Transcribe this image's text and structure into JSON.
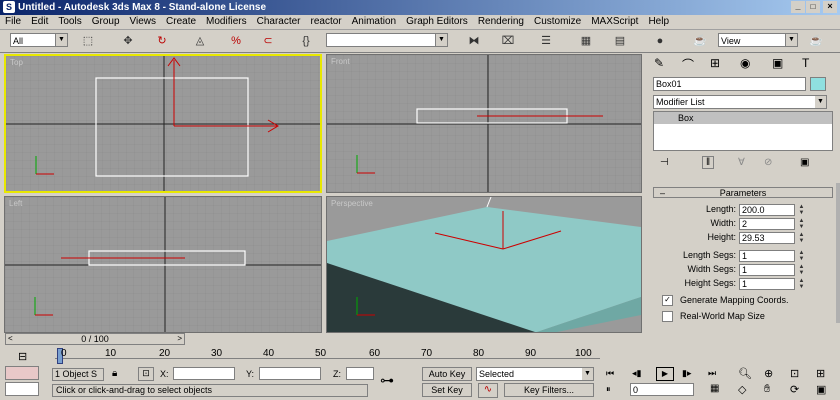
{
  "window": {
    "title": "Untitled - Autodesk 3ds Max 8 - Stand-alone License"
  },
  "menu": [
    "File",
    "Edit",
    "Tools",
    "Group",
    "Views",
    "Create",
    "Modifiers",
    "Character",
    "reactor",
    "Animation",
    "Graph Editors",
    "Rendering",
    "Customize",
    "MAXScript",
    "Help"
  ],
  "toolbar": {
    "selection_filter": "All",
    "named_selection": "",
    "view_combo": "View"
  },
  "viewports": {
    "top": "Top",
    "front": "Front",
    "left": "Left",
    "perspective": "Perspective"
  },
  "command_panel": {
    "object_name": "Box01",
    "modifier_list": "Modifier List",
    "stack_item": "Box",
    "rollout_title": "Parameters",
    "params": [
      {
        "label": "Length:",
        "value": "200.0"
      },
      {
        "label": "Width:",
        "value": "2"
      },
      {
        "label": "Height:",
        "value": "29.53"
      },
      {
        "label": "Length Segs:",
        "value": "1"
      },
      {
        "label": "Width Segs:",
        "value": "1"
      },
      {
        "label": "Height Segs:",
        "value": "1"
      }
    ],
    "checkboxes": [
      {
        "label": "Generate Mapping Coords.",
        "checked": true
      },
      {
        "label": "Real-World Map Size",
        "checked": false
      }
    ]
  },
  "timeline": {
    "slider_text": "0 / 100",
    "ticks": [
      "0",
      "10",
      "20",
      "30",
      "40",
      "50",
      "60",
      "70",
      "80",
      "90",
      "100"
    ]
  },
  "status": {
    "objects_selected": "1 Object S",
    "x_label": "X:",
    "y_label": "Y:",
    "z_label": "Z:",
    "x_value": "",
    "y_value": "",
    "z_value": "",
    "prompt": "Click or click-and-drag to select objects",
    "auto_key": "Auto Key",
    "set_key": "Set Key",
    "key_mode": "Selected",
    "key_filters": "Key Filters...",
    "frame": "0"
  },
  "colors": {
    "grid_bg": "#9a9a9a",
    "active_border": "#e8e800",
    "box_color": "#8fc9c6",
    "axis_red": "#c00000"
  }
}
